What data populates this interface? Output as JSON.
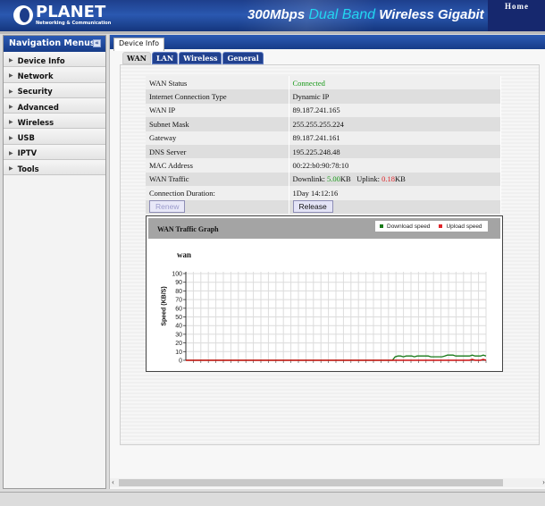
{
  "banner": {
    "logo_name": "PLANET",
    "logo_sub": "Networking & Communication",
    "product_prefix": "300Mbps ",
    "product_accent": "Dual Band",
    "product_suffix": " Wireless Gigabit Route",
    "home_link": "Home"
  },
  "sidebar": {
    "title": "Navigation Menus",
    "collapse_icon": "«",
    "items": [
      {
        "label": "Device Info"
      },
      {
        "label": "Network"
      },
      {
        "label": "Security"
      },
      {
        "label": "Advanced"
      },
      {
        "label": "Wireless"
      },
      {
        "label": "USB"
      },
      {
        "label": "IPTV"
      },
      {
        "label": "Tools"
      }
    ]
  },
  "main": {
    "page_tab": "Device Info",
    "subtabs": [
      {
        "label": "WAN",
        "active": true
      },
      {
        "label": "LAN",
        "active": false
      },
      {
        "label": "Wireless",
        "active": false
      },
      {
        "label": "General",
        "active": false
      }
    ],
    "info": {
      "wan_status_label": "WAN Status",
      "wan_status_value": "Connected",
      "conn_type_label": "Internet Connection Type",
      "conn_type_value": "Dynamic IP",
      "wan_ip_label": "WAN IP",
      "wan_ip_value": "89.187.241.165",
      "subnet_label": "Subnet Mask",
      "subnet_value": "255.255.255.224",
      "gateway_label": "Gateway",
      "gateway_value": "89.187.241.161",
      "dns_label": "DNS Server",
      "dns_value": "195.225.248.48",
      "mac_label": "MAC Address",
      "mac_value": "00:22:b0:90:78:10",
      "traffic_label": "WAN Traffic",
      "downlink_label": "Downlink: ",
      "downlink_value": "5.00",
      "downlink_unit": "KB",
      "uplink_label": "Uplink: ",
      "uplink_value": "0.18",
      "uplink_unit": "KB",
      "duration_label": "Connection Duration:",
      "duration_value": "1Day 14:12:16"
    },
    "buttons": {
      "renew": "Renew",
      "release": "Release"
    }
  },
  "graph": {
    "title": "WAN Traffic Graph",
    "name": "wan"
  },
  "colors": {
    "download": "#1a7a1a",
    "upload": "#cc1111"
  },
  "chart_data": {
    "type": "line",
    "title": "wan",
    "ylabel": "Speed (KB/S)",
    "xlabel": "",
    "ylim": [
      0,
      100
    ],
    "yticks": [
      0,
      10,
      20,
      30,
      40,
      50,
      60,
      70,
      80,
      90,
      100
    ],
    "grid": true,
    "legend": [
      "Download speed",
      "Upload speed"
    ],
    "legend_position": "top-right",
    "series": [
      {
        "name": "Download speed",
        "values": [
          0,
          0,
          0,
          0,
          0,
          0,
          0,
          0,
          0,
          0,
          0,
          0,
          0,
          0,
          0,
          0,
          0,
          0,
          0,
          0,
          0,
          0,
          0,
          0,
          0,
          0,
          0,
          0,
          0,
          0,
          0,
          0,
          0,
          0,
          0,
          0,
          0,
          0,
          0,
          0,
          0,
          0,
          0,
          0,
          0,
          0,
          0,
          0,
          0,
          0,
          0,
          0,
          0,
          0,
          0,
          0,
          0,
          0,
          0,
          0,
          0,
          0,
          0,
          0,
          0,
          0,
          0,
          0,
          0,
          0,
          0,
          0,
          0,
          0,
          0,
          0,
          4,
          5,
          5,
          4,
          5,
          5,
          5,
          4,
          5,
          5,
          5,
          5,
          5,
          4,
          4,
          4,
          4,
          4,
          5,
          6,
          6,
          6,
          5,
          5,
          5,
          5,
          5,
          5,
          6,
          5,
          5,
          5,
          6,
          5
        ]
      },
      {
        "name": "Upload speed",
        "values": [
          0,
          0,
          0,
          0,
          0,
          0,
          0,
          0,
          0,
          0,
          0,
          0,
          0,
          0,
          0,
          0,
          0,
          0,
          0,
          0,
          0,
          0,
          0,
          0,
          0,
          0,
          0,
          0,
          0,
          0,
          0,
          0,
          0,
          0,
          0,
          0,
          0,
          0,
          0,
          0,
          0,
          0,
          0,
          0,
          0,
          0,
          0,
          0,
          0,
          0,
          0,
          0,
          0,
          0,
          0,
          0,
          0,
          0,
          0,
          0,
          0,
          0,
          0,
          0,
          0,
          0,
          0,
          0,
          0,
          0,
          0,
          0,
          0,
          0,
          0,
          0,
          0,
          0,
          0,
          0,
          0,
          0,
          0,
          0,
          0,
          0,
          0,
          0,
          0,
          0,
          0,
          0,
          0,
          0,
          0,
          0,
          0,
          0,
          0,
          0,
          0,
          0,
          0,
          0,
          1,
          0,
          0,
          0,
          1,
          0
        ]
      }
    ]
  }
}
